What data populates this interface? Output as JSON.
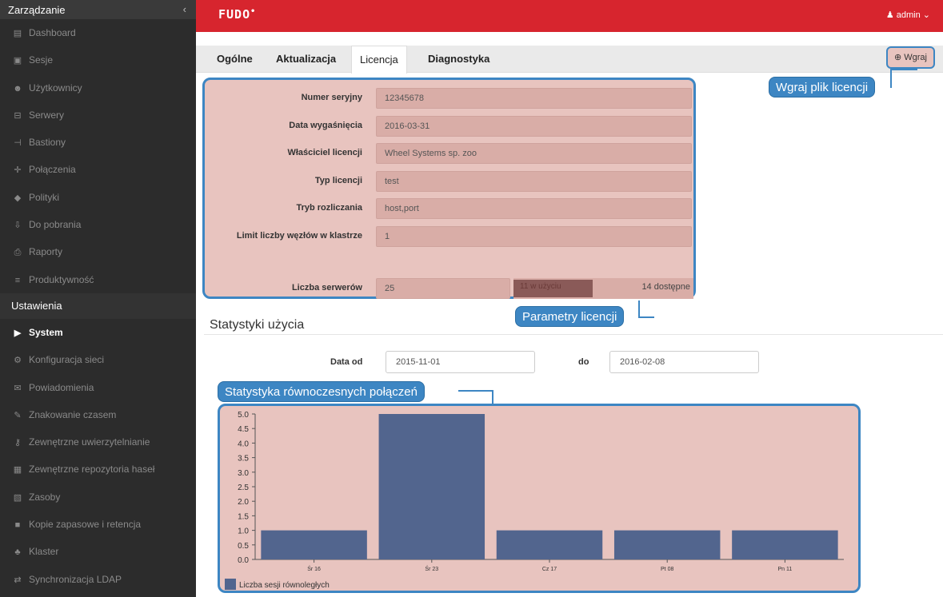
{
  "sidebar": {
    "header": "Zarządzanie",
    "collapse": "‹",
    "items": [
      {
        "label": "Dashboard",
        "icon": "▤"
      },
      {
        "label": "Sesje",
        "icon": "▣"
      },
      {
        "label": "Użytkownicy",
        "icon": "☻"
      },
      {
        "label": "Serwery",
        "icon": "⊟"
      },
      {
        "label": "Bastiony",
        "icon": "⊣"
      },
      {
        "label": "Połączenia",
        "icon": "✛"
      },
      {
        "label": "Polityki",
        "icon": "◆"
      },
      {
        "label": "Do pobrania",
        "icon": "⇩"
      },
      {
        "label": "Raporty",
        "icon": "⎙"
      },
      {
        "label": "Produktywność",
        "icon": "≡"
      }
    ],
    "section2": "Ustawienia",
    "items2": [
      {
        "label": "System",
        "icon": "▶"
      },
      {
        "label": "Konfiguracja sieci",
        "icon": "⚙"
      },
      {
        "label": "Powiadomienia",
        "icon": "✉"
      },
      {
        "label": "Znakowanie czasem",
        "icon": "✎"
      },
      {
        "label": "Zewnętrzne uwierzytelnianie",
        "icon": "⚷"
      },
      {
        "label": "Zewnętrzne repozytoria haseł",
        "icon": "▦"
      },
      {
        "label": "Zasoby",
        "icon": "▧"
      },
      {
        "label": "Kopie zapasowe i retencja",
        "icon": "■"
      },
      {
        "label": "Klaster",
        "icon": "♣"
      },
      {
        "label": "Synchronizacja LDAP",
        "icon": "⇄"
      }
    ]
  },
  "topbar": {
    "logo": "FUDO",
    "logo_mark": "•",
    "user": "admin",
    "user_caret": "⌄",
    "user_icon": "♟"
  },
  "tabs": [
    "Ogólne",
    "Aktualizacja",
    "Licencja",
    "Diagnostyka"
  ],
  "upload_button": "⊕ Wgraj",
  "callouts": {
    "upload": "Wgraj plik licencji",
    "params": "Parametry licencji",
    "chart": "Statystyka równoczesnych połączeń"
  },
  "license": [
    {
      "label": "Numer seryjny",
      "value": "12345678"
    },
    {
      "label": "Data wygaśnięcia",
      "value": "2016-03-31"
    },
    {
      "label": "Właściciel licencji",
      "value": "Wheel Systems sp. zoo"
    },
    {
      "label": "Typ licencji",
      "value": "test"
    },
    {
      "label": "Tryb rozliczania",
      "value": "host,port"
    },
    {
      "label": "Limit liczby węzłów w klastrze",
      "value": "1"
    }
  ],
  "servers": {
    "label": "Liczba serwerów",
    "value": "25",
    "used": "11 w użyciu",
    "used_fraction": 0.44,
    "available": "14 dostępne"
  },
  "stats": {
    "title": "Statystyki użycia",
    "from_label": "Data od",
    "from_value": "2015-11-01",
    "to_label": "do",
    "to_value": "2016-02-08"
  },
  "colors": {
    "bar": "#52658e",
    "accent": "#d7252e",
    "highlight": "#3d86c3"
  },
  "chart_data": {
    "type": "bar",
    "categories": [
      "Śr 16",
      "Śr 23",
      "Cz 17",
      "Pt 08",
      "Pn 11"
    ],
    "series": [
      {
        "name": "Liczba sesji równoległych",
        "values": [
          1,
          5,
          1,
          1,
          1
        ]
      }
    ],
    "ylim": [
      0,
      5
    ],
    "yticks": [
      "5.0",
      "4.5",
      "4.0",
      "3.5",
      "3.0",
      "2.5",
      "2.0",
      "1.5",
      "1.0",
      "0.5",
      "0.0"
    ],
    "legend": "bottom-left"
  }
}
